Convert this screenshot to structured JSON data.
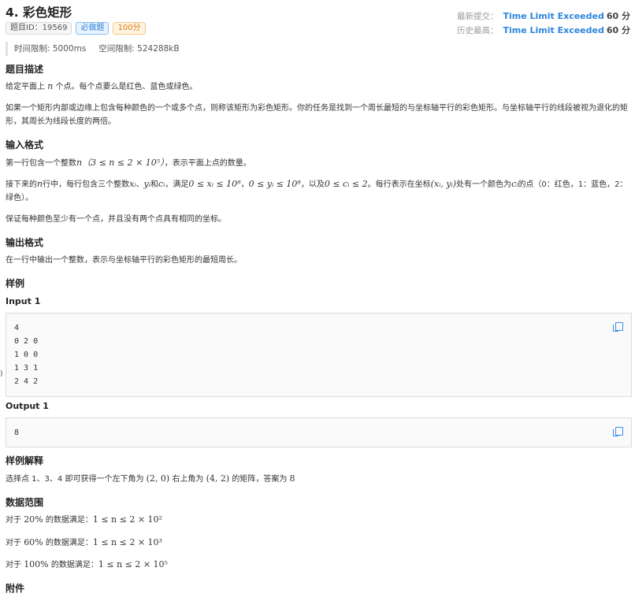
{
  "problem": {
    "title": "4. 彩色矩形",
    "id_tag": "题目ID：19569",
    "required_tag": "必做题",
    "score_tag": "100分"
  },
  "status": {
    "latest_label": "最新提交：",
    "latest_result": "Time Limit Exceeded",
    "latest_score": "60 分",
    "best_label": "历史最高：",
    "best_result": "Time Limit Exceeded",
    "best_score": "60 分"
  },
  "limits": {
    "time": "时间限制: 5000ms",
    "memory": "空间限制: 524288kB"
  },
  "description": {
    "heading": "题目描述",
    "p1_a": "给定平面上 ",
    "p1_n": "n",
    "p1_b": " 个点。每个点要么是红色、蓝色或绿色。",
    "p2": "如果一个矩形内部或边缘上包含每种颜色的一个或多个点，则称该矩形为彩色矩形。你的任务是找到一个周长最短的与坐标轴平行的彩色矩形。与坐标轴平行的线段被视为退化的矩形，其周长为线段长度的两倍。"
  },
  "input_format": {
    "heading": "输入格式",
    "l1_a": "第一行包含一个整数",
    "l1_math": "n（3 ≤ n ≤ 2 × 10⁵）",
    "l1_b": "，表示平面上点的数量。",
    "l2_a": "接下来的",
    "l2_n": "n",
    "l2_b": "行中，每行包含三个整数",
    "l2_x": "xᵢ",
    "l2_c1": "、",
    "l2_y": "yᵢ",
    "l2_c2": "和",
    "l2_c": "cᵢ",
    "l2_c3": "，满足",
    "l2_r1": "0 ≤ xᵢ ≤ 10⁸",
    "l2_c4": "，",
    "l2_r2": "0 ≤ yᵢ ≤ 10⁸",
    "l2_c5": "，以及",
    "l2_r3": "0 ≤ cᵢ ≤ 2",
    "l2_c6": "。每行表示在坐标",
    "l2_xy": "(xᵢ, yᵢ)",
    "l2_c7": "处有一个颜色为",
    "l2_ci": "cᵢ",
    "l2_c8": "的点（0：红色，1：蓝色，2：绿色）。",
    "l3": "保证每种颜色至少有一个点，并且没有两个点具有相同的坐标。"
  },
  "output_format": {
    "heading": "输出格式",
    "l1": "在一行中输出一个整数，表示与坐标轴平行的彩色矩形的最短周长。"
  },
  "samples": {
    "heading": "样例",
    "input_label": "Input 1",
    "input_lines": [
      "4",
      "0 2 0",
      "1 0 0",
      "1 3 1",
      "2 4 2"
    ],
    "output_label": "Output 1",
    "output_lines": [
      "8"
    ]
  },
  "explanation": {
    "heading": "样例解释",
    "a": "选择点 1、3、4 即可获得一个左下角为 ",
    "p1": "(2,  0)",
    "b": " 右上角为 ",
    "p2": "(4,  2)",
    "c": " 的矩阵，答案为 ",
    "ans": "8"
  },
  "constraints": {
    "heading": "数据范围",
    "rows": [
      {
        "a": "对于 ",
        "pct": "20%",
        "b": " 的数据满足：",
        "math": "1 ≤ n ≤ 2 × 10²"
      },
      {
        "a": "对于 ",
        "pct": "60%",
        "b": " 的数据满足：",
        "math": "1 ≤ n ≤ 2 × 10³"
      },
      {
        "a": "对于 ",
        "pct": "100%",
        "b": " 的数据满足：",
        "math": "1 ≤ n ≤ 2 × 10⁵"
      }
    ]
  },
  "attachments": {
    "heading": "附件"
  },
  "edge_glyph": ")",
  "colors": {
    "accent": "#2e86de",
    "required_tag": "#2c7fd8",
    "score_tag": "#d97f10"
  },
  "icons": [
    "copy-icon"
  ]
}
